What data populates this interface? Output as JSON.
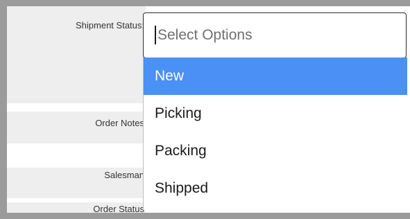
{
  "form": {
    "labels": {
      "shipment_status": "Shipment Status:",
      "order_notes": "Order Notes",
      "salesman": "Salesman",
      "order_status": "Order Status"
    }
  },
  "shipment_dropdown": {
    "placeholder": "Select Options",
    "options": [
      "New",
      "Picking",
      "Packing",
      "Shipped"
    ],
    "highlighted": "New"
  },
  "colors": {
    "highlight": "#4a90f5",
    "label_background": "#eeeeee",
    "frame": "#9b9b9b"
  }
}
